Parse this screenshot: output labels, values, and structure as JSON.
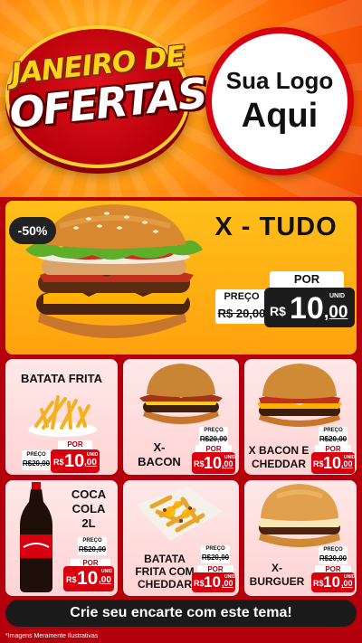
{
  "header": {
    "badge_line1": "JANEIRO DE",
    "badge_line2": "OFERTAS",
    "logo_line1": "Sua Logo",
    "logo_line2": "Aqui"
  },
  "featured": {
    "discount": "-50%",
    "title": "X - TUDO",
    "por_label": "POR",
    "old_label": "PREÇO",
    "old_price": "R$ 20,00",
    "currency": "R$",
    "price_int": "10",
    "price_cents": ",00",
    "unit": "UNID"
  },
  "products": [
    {
      "name": "BATATA FRITA",
      "old_label": "PREÇO",
      "old_price": "R$20,00",
      "por_label": "POR",
      "currency": "R$",
      "price_int": "10",
      "price_cents": ",00",
      "unit": "UNID"
    },
    {
      "name_line1": "X-",
      "name_line2": "BACON",
      "old_label": "PREÇO",
      "old_price": "R$20,00",
      "por_label": "POR",
      "currency": "R$",
      "price_int": "10",
      "price_cents": ",00",
      "unit": "UNID"
    },
    {
      "name_line1": "X BACON E",
      "name_line2": "CHEDDAR",
      "old_label": "PREÇO",
      "old_price": "R$20,00",
      "por_label": "POR",
      "currency": "R$",
      "price_int": "10",
      "price_cents": ",00",
      "unit": "UNID"
    },
    {
      "name_line1": "COCA",
      "name_line2": "COLA",
      "name_line3": "2L",
      "old_label": "PREÇO",
      "old_price": "R$20,00",
      "por_label": "POR",
      "currency": "R$",
      "price_int": "10",
      "price_cents": ",00",
      "unit": "UNID"
    },
    {
      "name_line1": "BATATA",
      "name_line2": "FRITA COM",
      "name_line3": "CHEDDAR",
      "old_label": "PREÇO",
      "old_price": "R$20,00",
      "por_label": "POR",
      "currency": "R$",
      "price_int": "10",
      "price_cents": ",00",
      "unit": "UNID"
    },
    {
      "name_line1": "X-",
      "name_line2": "BURGUER",
      "old_label": "PREÇO",
      "old_price": "R$20,00",
      "por_label": "POR",
      "currency": "R$",
      "price_int": "10",
      "price_cents": ",00",
      "unit": "UNID"
    }
  ],
  "cta_text": "Crie seu encarte com este tema!",
  "footnote": "*Imagens Meramente Ilustrativas",
  "colors": {
    "brand_red": "#d6000f",
    "background_red": "#b3000c",
    "featured_yellow": "#ffb314",
    "card_pink": "#ffe0e0",
    "dark": "#1c1c1c"
  },
  "icons": [
    "burger-illustration",
    "fries-illustration",
    "soda-bottle-illustration",
    "cheddar-fries-illustration"
  ]
}
